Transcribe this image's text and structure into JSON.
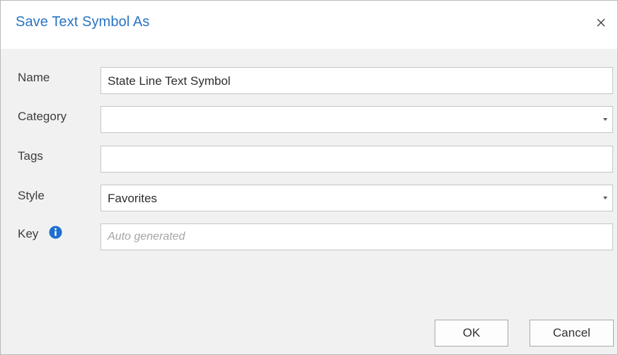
{
  "dialog": {
    "title": "Save Text Symbol As",
    "close_icon": "close-icon"
  },
  "fields": {
    "name": {
      "label": "Name",
      "value": "State Line Text Symbol"
    },
    "category": {
      "label": "Category",
      "value": ""
    },
    "tags": {
      "label": "Tags",
      "value": ""
    },
    "style": {
      "label": "Style",
      "value": "Favorites"
    },
    "key": {
      "label": "Key",
      "placeholder": "Auto generated",
      "info_icon": "info-icon"
    }
  },
  "buttons": {
    "ok": "OK",
    "cancel": "Cancel"
  },
  "colors": {
    "title": "#2b74c4",
    "info_icon": "#1e6fd0",
    "body_background": "#f1f1f1"
  }
}
